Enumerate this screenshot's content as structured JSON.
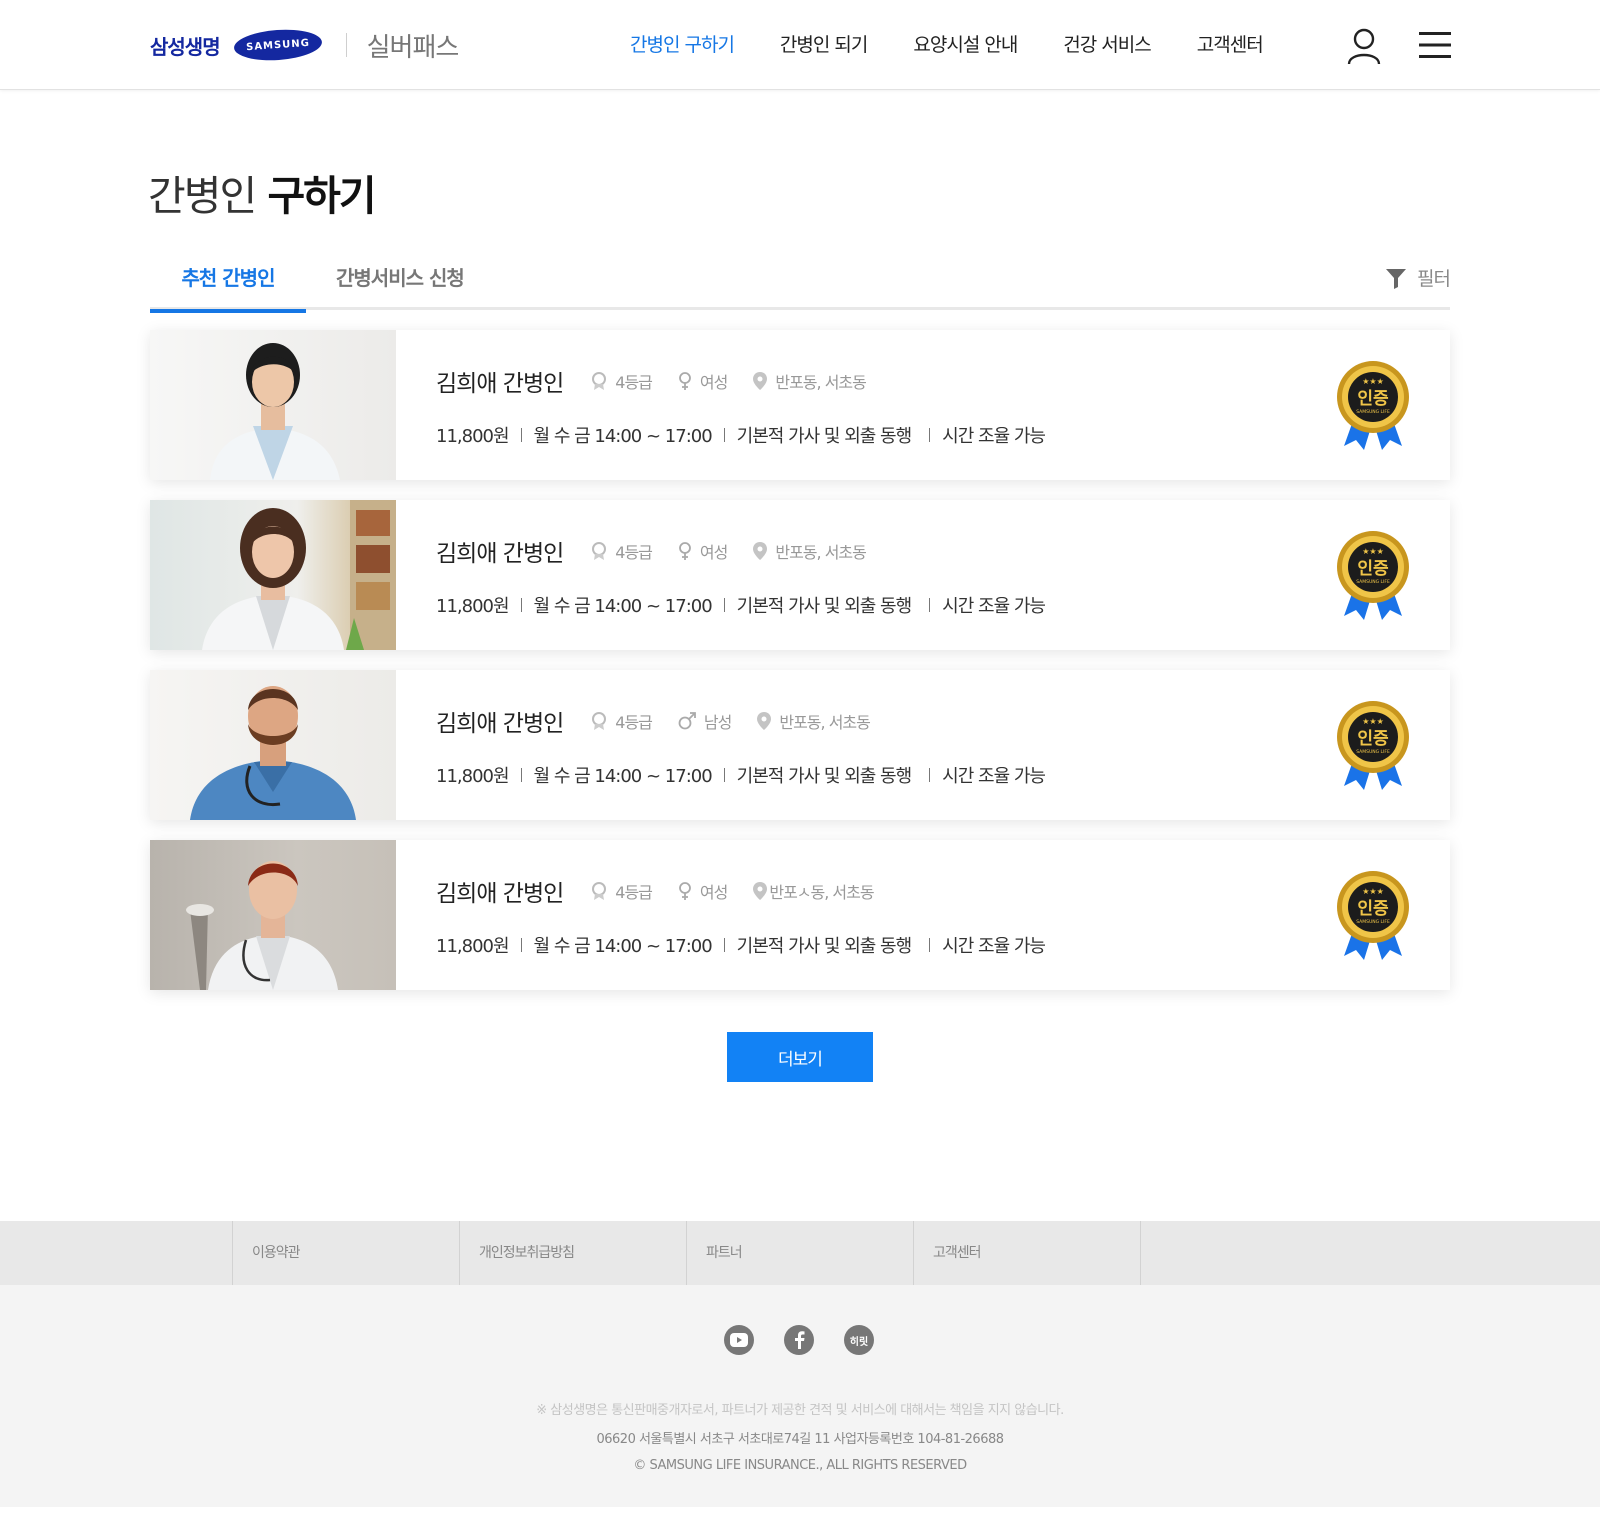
{
  "header": {
    "brand_korean": "삼성생명",
    "brand_samsung": "SAMSUNG",
    "service_name": "실버패스",
    "nav": [
      {
        "label": "간병인 구하기",
        "active": true
      },
      {
        "label": "간병인 되기",
        "active": false
      },
      {
        "label": "요양시설 안내",
        "active": false
      },
      {
        "label": "건강 서비스",
        "active": false
      },
      {
        "label": "고객센터",
        "active": false
      }
    ],
    "user_icon": "user-icon",
    "menu_icon": "hamburger-menu-icon"
  },
  "page": {
    "title_light": "간병인",
    "title_bold": "구하기"
  },
  "tabs": {
    "items": [
      {
        "label": "추천 간병인",
        "active": true
      },
      {
        "label": "간병서비스 신청",
        "active": false
      }
    ],
    "filter_label": "필터",
    "filter_icon": "funnel-icon"
  },
  "caregivers": [
    {
      "name": "김희애 간병인",
      "grade": "4등급",
      "gender": "여성",
      "gender_icon": "female-icon",
      "location": "반포동, 서초동",
      "price": "11,800원",
      "schedule": "월 수 금 14:00 ~ 17:00",
      "service": "기본적 가사 및 외출 동행",
      "flex": "시간 조율 가능",
      "badge_text": "인증",
      "badge_sub": "SAMSUNG LIFE",
      "photo": "female-doctor-1"
    },
    {
      "name": "김희애 간병인",
      "grade": "4등급",
      "gender": "여성",
      "gender_icon": "female-icon",
      "location": "반포동, 서초동",
      "price": "11,800원",
      "schedule": "월 수 금 14:00 ~ 17:00",
      "service": "기본적 가사 및 외출 동행",
      "flex": "시간 조율 가능",
      "badge_text": "인증",
      "badge_sub": "SAMSUNG LIFE",
      "photo": "female-doctor-2"
    },
    {
      "name": "김희애 간병인",
      "grade": "4등급",
      "gender": "남성",
      "gender_icon": "male-icon",
      "location": "반포동, 서초동",
      "price": "11,800원",
      "schedule": "월 수 금 14:00 ~ 17:00",
      "service": "기본적 가사 및 외출 동행",
      "flex": "시간 조율 가능",
      "badge_text": "인증",
      "badge_sub": "SAMSUNG LIFE",
      "photo": "male-nurse"
    },
    {
      "name": "김희애 간병인",
      "grade": "4등급",
      "gender": "여성",
      "gender_icon": "female-icon",
      "location": "반포ㅅ동, 서초동",
      "price": "11,800원",
      "schedule": "월 수 금 14:00 ~ 17:00",
      "service": "기본적 가사 및 외출 동행",
      "flex": "시간 조율 가능",
      "badge_text": "인증",
      "badge_sub": "SAMSUNG LIFE",
      "photo": "female-doctor-3"
    }
  ],
  "more_button": "더보기",
  "footer": {
    "links": [
      "이용약관",
      "개인정보취급방침",
      "파트너",
      "고객센터"
    ],
    "social": [
      {
        "icon": "youtube-icon",
        "label": ""
      },
      {
        "icon": "facebook-icon",
        "label": ""
      },
      {
        "icon": "hirit-icon",
        "label": "히릿"
      }
    ],
    "disclaimer": "※ 삼성생명은 통신판매중개자로서, 파트너가 제공한 견적 및 서비스에 대해서는 책임을 지지 않습니다.",
    "address": "06620 서울특별시 서초구 서초대로74길 11    사업자등록번호 104-81-26688",
    "copyright": "© SAMSUNG LIFE INSURANCE., ALL RIGHTS RESERVED"
  },
  "colors": {
    "accent": "#1677e5",
    "button": "#1282f5",
    "brand_navy": "#1428a0",
    "badge_gold": "#d4a72c",
    "badge_ribbon": "#1a73e8"
  }
}
